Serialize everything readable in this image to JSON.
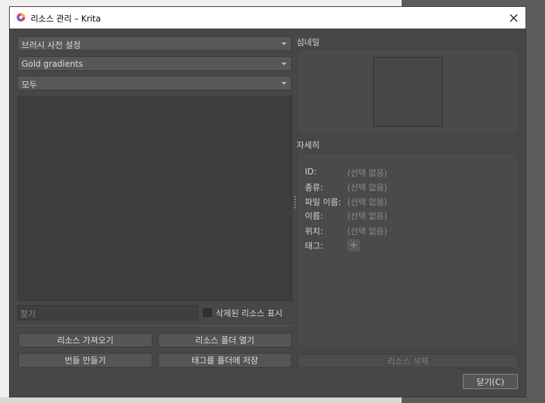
{
  "window": {
    "title": "리소스 관리 – Krita"
  },
  "left": {
    "resource_type": "브러시 사전 설정",
    "storage": "Gold gradients",
    "tag_filter": "모두",
    "search_placeholder": "찾기",
    "show_deleted_label": "삭제된 리소스 표시",
    "buttons": {
      "import": "리소스 가져오기",
      "open_folder": "리소스 폴더 열기",
      "create_bundle": "번들 만들기",
      "save_tags": "태그를 폴더에 저장"
    }
  },
  "right": {
    "thumbnail_label": "섬네일",
    "details_label": "자세히",
    "details": [
      {
        "label": "ID:",
        "value": "(선택 없음)"
      },
      {
        "label": "종류:",
        "value": "(선택 없음)"
      },
      {
        "label": "파일 이름:",
        "value": "(선택 없음)"
      },
      {
        "label": "이름:",
        "value": "(선택 없음)"
      },
      {
        "label": "위치:",
        "value": "(선택 없음)"
      }
    ],
    "tags_label": "태그:",
    "tag_add_symbol": "+",
    "delete_button": "리소스 삭제"
  },
  "footer": {
    "close_button": "닫기(C)"
  },
  "colors": {
    "dialog_bg": "#474747",
    "list_bg": "#3d3d3d",
    "accent": "#6d8fb5"
  }
}
